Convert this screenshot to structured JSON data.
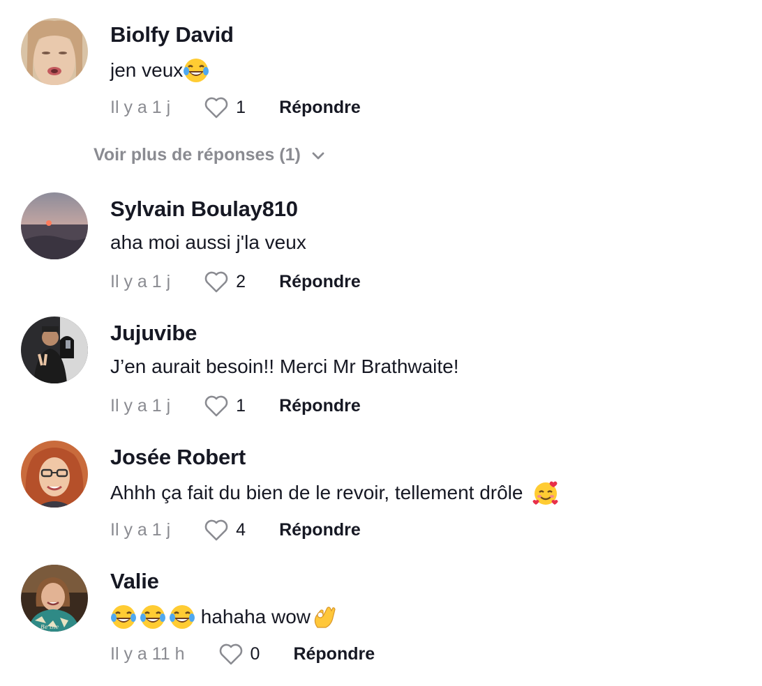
{
  "comments": [
    {
      "username": "Biolfy David",
      "text_before": "jen veux",
      "text_after": "",
      "emojis": [
        "face-with-tears-of-joy"
      ],
      "time": "Il y a 1 j",
      "likes": "1",
      "reply_label": "Répondre"
    },
    {
      "username": "Sylvain Boulay810",
      "text_before": "aha moi aussi j'la veux",
      "text_after": "",
      "emojis": [],
      "time": "Il y a 1 j",
      "likes": "2",
      "reply_label": "Répondre"
    },
    {
      "username": "Jujuvibe",
      "text_before": "J’en aurait besoin!! Merci Mr Brathwaite!",
      "text_after": "",
      "emojis": [],
      "time": "Il y a 1 j",
      "likes": "1",
      "reply_label": "Répondre"
    },
    {
      "username": "Josée Robert",
      "text_before": "Ahhh ça fait du bien de le revoir, tellement drôle ",
      "text_after": "",
      "emojis": [
        "smiling-face-with-hearts"
      ],
      "time": "Il y a 1 j",
      "likes": "4",
      "reply_label": "Répondre"
    },
    {
      "username": "Valie",
      "text_before": "",
      "text_after": " hahaha wow",
      "emojis": [
        "face-with-tears-of-joy",
        "face-with-tears-of-joy",
        "face-with-tears-of-joy",
        "ok-hand"
      ],
      "time": "Il y a 11 h",
      "likes": "0",
      "reply_label": "Répondre"
    }
  ],
  "view_more_replies": "Voir plus de réponses (1)",
  "icons": {
    "like": "heart-outline-icon",
    "expand": "chevron-down-icon"
  },
  "colors": {
    "text": "#161823",
    "muted": "#8a8b91"
  }
}
